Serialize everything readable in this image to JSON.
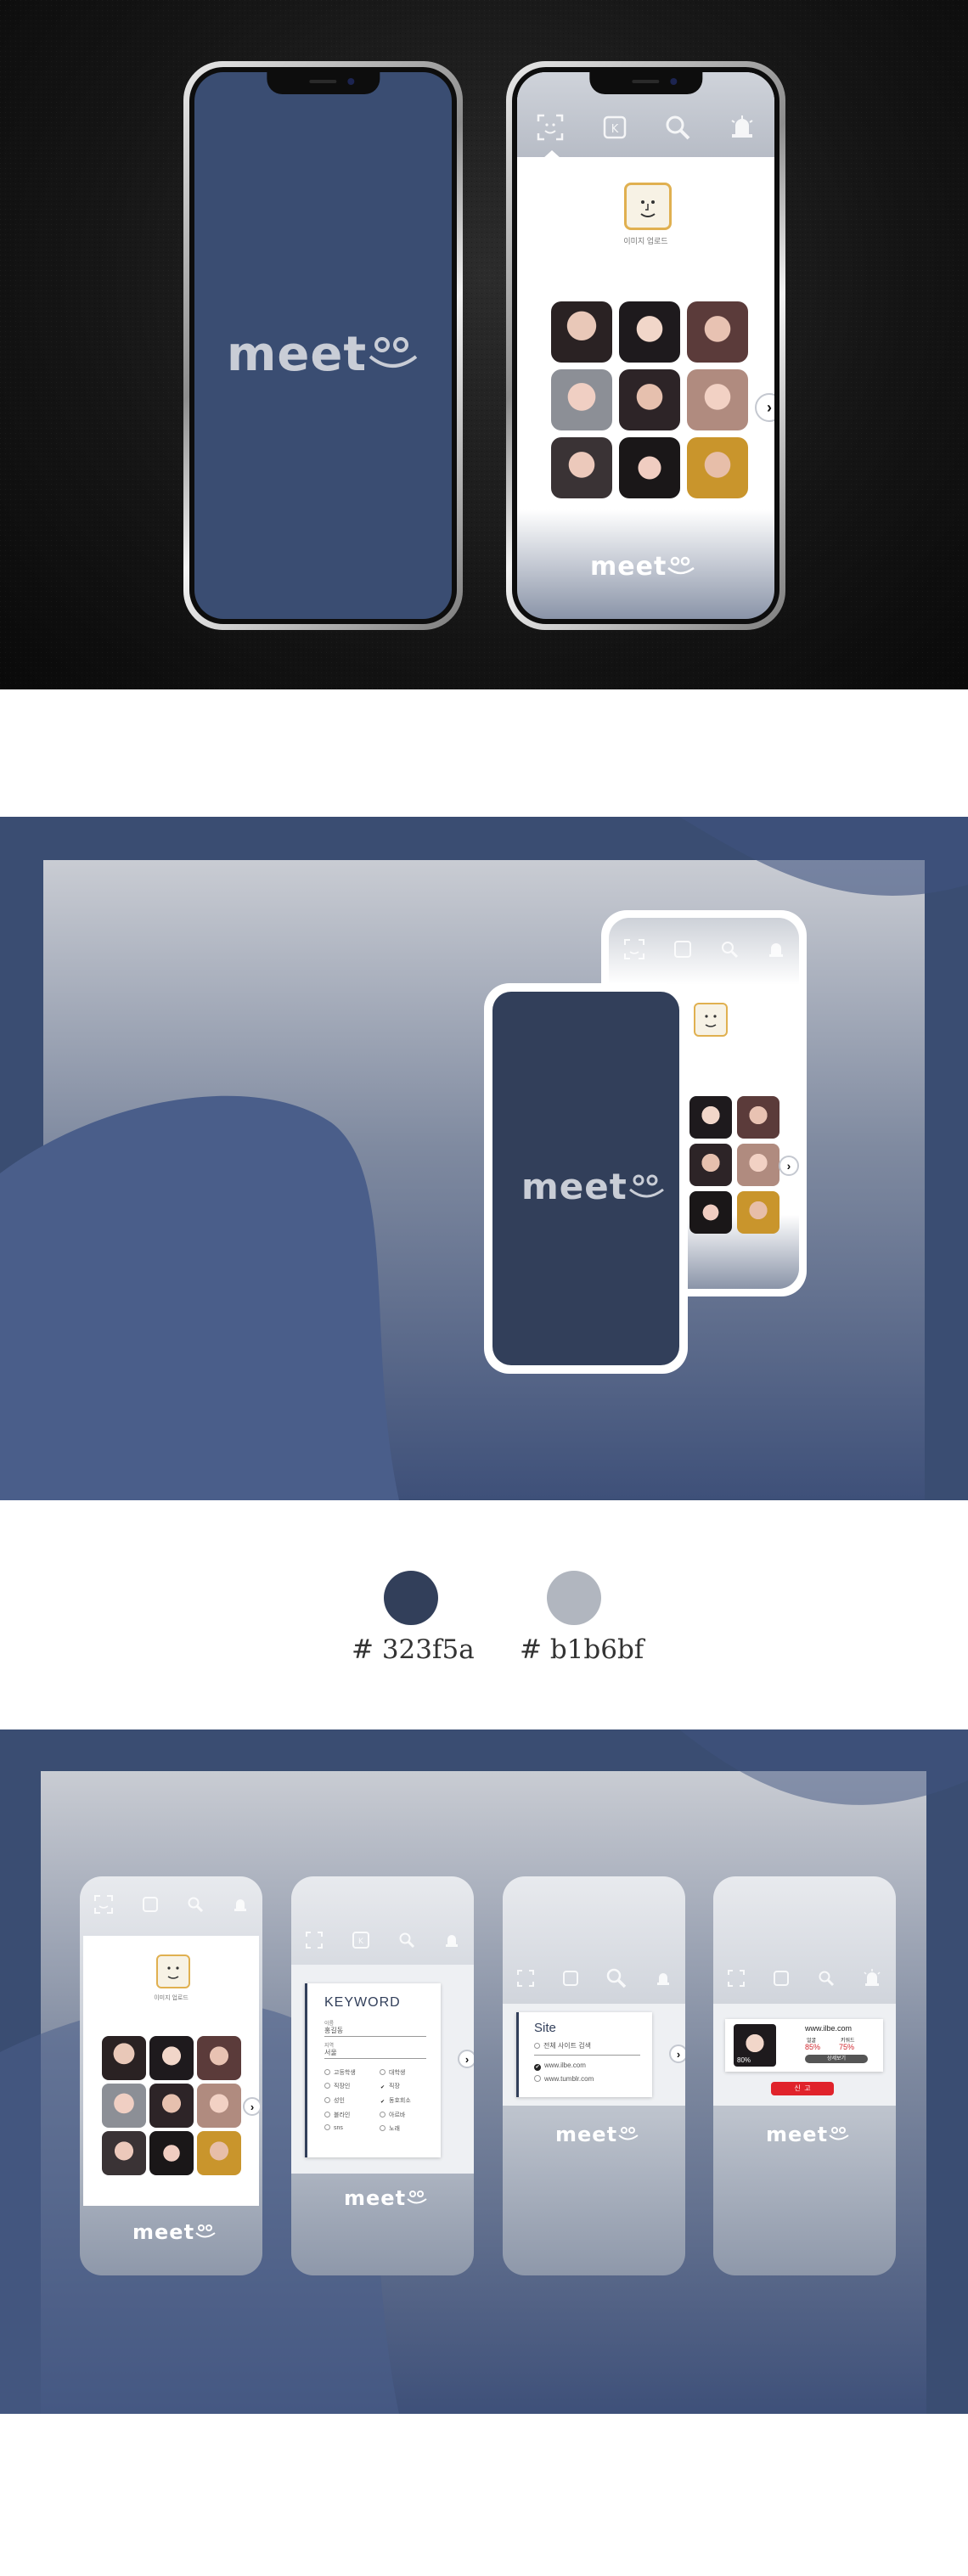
{
  "brand": {
    "logo_text": "meet",
    "logo_smile": "◡◡",
    "upload_label": "이미지 업로드"
  },
  "colors": {
    "primary": "#323f5a",
    "secondary": "#b1b6bf"
  },
  "palette": {
    "primary_label": "# 323f5a",
    "secondary_label": "# b1b6bf"
  },
  "tabs": [
    {
      "icon": "face-scan-icon"
    },
    {
      "icon": "keyword-search-icon"
    },
    {
      "icon": "site-search-icon"
    },
    {
      "icon": "alarm-icon"
    }
  ],
  "keyword_panel": {
    "title": "KEYWORD",
    "field1_label": "이름",
    "field1_value": "홍길동",
    "field2_label": "지역",
    "field2_value": "서울",
    "options": [
      {
        "label": "고등학생",
        "checked": false
      },
      {
        "label": "대학생",
        "checked": false
      },
      {
        "label": "직장인",
        "checked": false
      },
      {
        "label": "직장",
        "checked": true
      },
      {
        "label": "성인",
        "checked": false
      },
      {
        "label": "동호회소",
        "checked": true
      },
      {
        "label": "블라인",
        "checked": false
      },
      {
        "label": "아르바",
        "checked": false
      },
      {
        "label": "sns",
        "checked": false
      },
      {
        "label": "노래",
        "checked": false
      }
    ]
  },
  "site_panel": {
    "title": "Site",
    "all_label": "전체 사이트 검색",
    "sites": [
      {
        "label": "www.ilbe.com",
        "checked": true
      },
      {
        "label": "www.tumblr.com",
        "checked": false
      }
    ]
  },
  "report_panel": {
    "site": "www.ilbe.com",
    "face_label": "얼굴",
    "face_value": "85%",
    "keyword_label": "키워드",
    "keyword_value": "75%",
    "match_value": "80%",
    "detail_button": "상세보기",
    "report_button": "신  고"
  }
}
